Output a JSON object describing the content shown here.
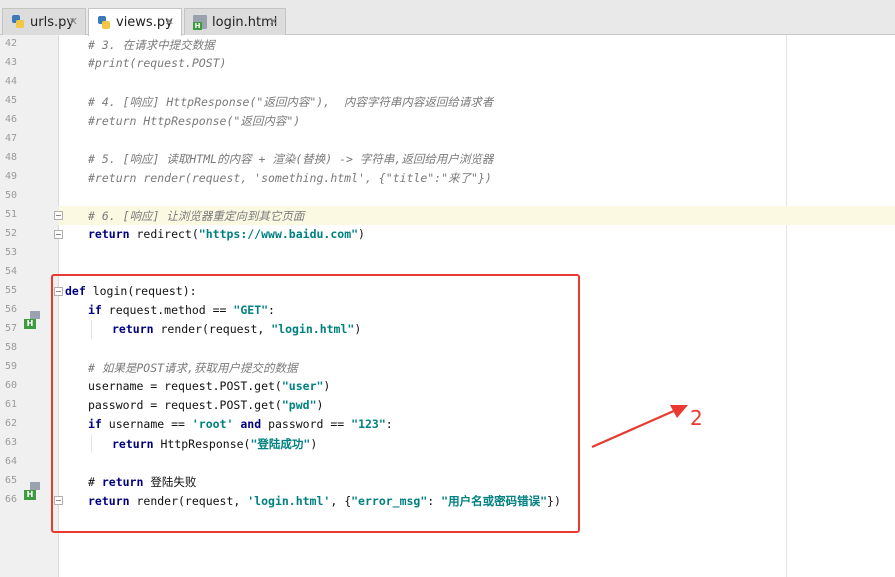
{
  "tabs": [
    {
      "label": "urls.py",
      "icon": "python-file-icon",
      "active": false
    },
    {
      "label": "views.py",
      "icon": "python-file-icon",
      "active": true
    },
    {
      "label": "login.html",
      "icon": "html-file-icon",
      "active": false
    }
  ],
  "tab_close_glyph": "✕",
  "lines": [
    {
      "n": "42",
      "code": "# 3. 在请求中提交数据"
    },
    {
      "n": "43",
      "code": "#print(request.POST)"
    },
    {
      "n": "44",
      "code": ""
    },
    {
      "n": "45",
      "code": "# 4. [响应] HttpResponse(\"返回内容\"),  内容字符串内容返回给请求者"
    },
    {
      "n": "46",
      "code": "#return HttpResponse(\"返回内容\")"
    },
    {
      "n": "47",
      "code": ""
    },
    {
      "n": "48",
      "code": "# 5. [响应] 读取HTML的内容 + 渲染(替换) -> 字符串,返回给用户浏览器"
    },
    {
      "n": "49",
      "code": "#return render(request, 'something.html', {\"title\":\"来了\"})"
    },
    {
      "n": "50",
      "code": ""
    },
    {
      "n": "51",
      "code": "# 6. [响应] 让浏览器重定向到其它页面"
    },
    {
      "n": "52",
      "code": "return redirect(\"https://www.baidu.com\")"
    },
    {
      "n": "53",
      "code": ""
    },
    {
      "n": "54",
      "code": ""
    },
    {
      "n": "55",
      "code": "def login(request):"
    },
    {
      "n": "56",
      "code": "if request.method == \"GET\":"
    },
    {
      "n": "57",
      "code": "return render(request, \"login.html\")"
    },
    {
      "n": "58",
      "code": ""
    },
    {
      "n": "59",
      "code": "# 如果是POST请求,获取用户提交的数据"
    },
    {
      "n": "60",
      "code": "username = request.POST.get(\"user\")"
    },
    {
      "n": "61",
      "code": "password = request.POST.get(\"pwd\")"
    },
    {
      "n": "62",
      "code": "if username == 'root' and password == \"123\":"
    },
    {
      "n": "63",
      "code": "return HttpResponse(\"登陆成功\")"
    },
    {
      "n": "64",
      "code": ""
    },
    {
      "n": "65",
      "code": "# return 登陆失败"
    },
    {
      "n": "66",
      "code": "return render(request, 'login.html', {\"error_msg\": \"用户名或密码错误\"})"
    }
  ],
  "gutter_badge": "H",
  "annotation": {
    "label": "2",
    "color": "#e83a30"
  },
  "colors": {
    "keyword": "#000080",
    "string": "#008080",
    "comment": "#7a7a7a",
    "line_highlight": "#fcf9e2"
  }
}
